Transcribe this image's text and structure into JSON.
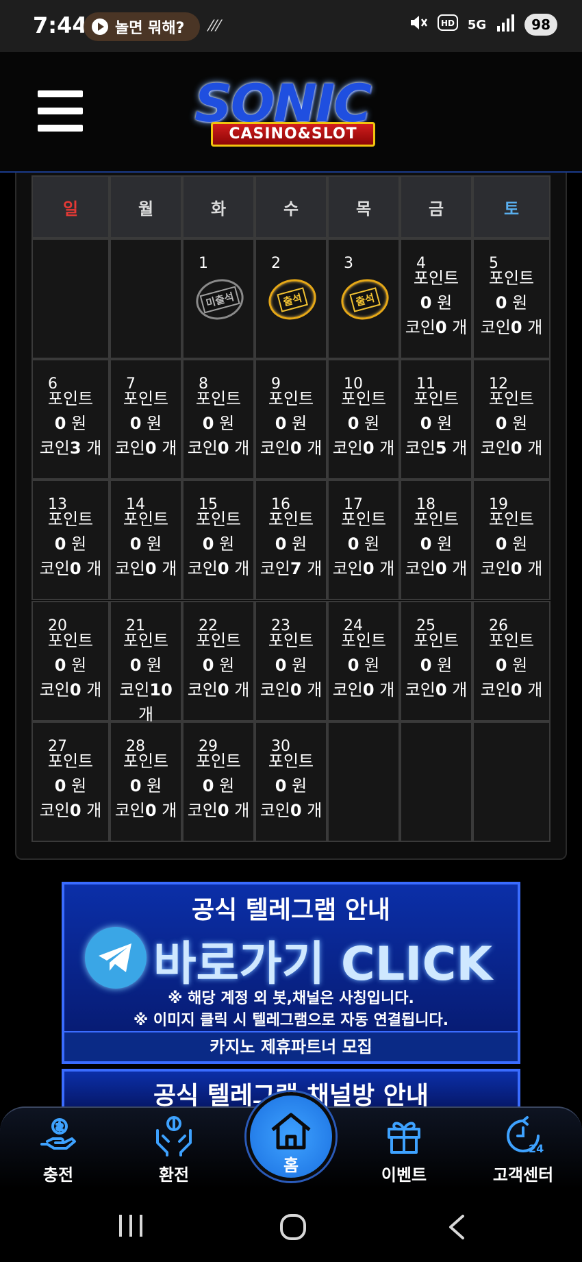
{
  "status_bar": {
    "time": "7:44",
    "pill_label": "놀면 뭐해?",
    "misc": "⁄⁄⁄ ",
    "network": "5G",
    "battery": "98"
  },
  "header": {
    "logo_title": "SONIC",
    "logo_subtitle": "CASINO&SLOT"
  },
  "calendar": {
    "weekdays": [
      "일",
      "월",
      "화",
      "수",
      "목",
      "금",
      "토"
    ],
    "point_label": "포인트",
    "won_unit": "원",
    "coin_label": "코인",
    "count_unit": "개",
    "stamps": {
      "1": "미출석",
      "2": "출석",
      "3": "출석"
    },
    "days": [
      {
        "day": "4",
        "points": "0",
        "coins": "0"
      },
      {
        "day": "5",
        "points": "0",
        "coins": "0"
      },
      {
        "day": "6",
        "points": "0",
        "coins": "3"
      },
      {
        "day": "7",
        "points": "0",
        "coins": "0"
      },
      {
        "day": "8",
        "points": "0",
        "coins": "0"
      },
      {
        "day": "9",
        "points": "0",
        "coins": "0"
      },
      {
        "day": "10",
        "points": "0",
        "coins": "0"
      },
      {
        "day": "11",
        "points": "0",
        "coins": "5"
      },
      {
        "day": "12",
        "points": "0",
        "coins": "0"
      },
      {
        "day": "13",
        "points": "0",
        "coins": "0"
      },
      {
        "day": "14",
        "points": "0",
        "coins": "0"
      },
      {
        "day": "15",
        "points": "0",
        "coins": "0"
      },
      {
        "day": "16",
        "points": "0",
        "coins": "7"
      },
      {
        "day": "17",
        "points": "0",
        "coins": "0"
      },
      {
        "day": "18",
        "points": "0",
        "coins": "0"
      },
      {
        "day": "19",
        "points": "0",
        "coins": "0"
      },
      {
        "day": "20",
        "points": "0",
        "coins": "0"
      },
      {
        "day": "21",
        "points": "0",
        "coins": "10"
      },
      {
        "day": "22",
        "points": "0",
        "coins": "0"
      },
      {
        "day": "23",
        "points": "0",
        "coins": "0"
      },
      {
        "day": "24",
        "points": "0",
        "coins": "0"
      },
      {
        "day": "25",
        "points": "0",
        "coins": "0"
      },
      {
        "day": "26",
        "points": "0",
        "coins": "0"
      },
      {
        "day": "27",
        "points": "0",
        "coins": "0"
      },
      {
        "day": "28",
        "points": "0",
        "coins": "0"
      },
      {
        "day": "29",
        "points": "0",
        "coins": "0"
      },
      {
        "day": "30",
        "points": "0",
        "coins": "0"
      }
    ]
  },
  "banner1": {
    "title": "공식 텔레그램 안내",
    "cta": "바로가기 CLICK",
    "note1": "※ 해당 계정 외 봇,채널은 사칭입니다.",
    "note2": "※ 이미지 클릭 시 텔레그램으로 자동 연결됩니다.",
    "footer": "카지노 제휴파트너 모집"
  },
  "banner2": {
    "title": "공식 텔레그램 채널방 안내"
  },
  "bottom_nav": {
    "charge": "충전",
    "exchange": "환전",
    "home": "홈",
    "event": "이벤트",
    "support": "고객센터"
  },
  "icons": [
    "play-icon",
    "mute-icon",
    "hd-icon",
    "signal-icon",
    "hamburger-menu-icon",
    "telegram-icon",
    "charge-icon",
    "exchange-icon",
    "home-icon",
    "gift-icon",
    "support-24-icon",
    "recents-icon",
    "home-circle-icon",
    "back-icon"
  ],
  "colors": {
    "sunday": "#e53935",
    "saturday": "#5ab0f0",
    "accent_blue": "#1a6fe0",
    "stamp_gold": "#e6a817"
  }
}
